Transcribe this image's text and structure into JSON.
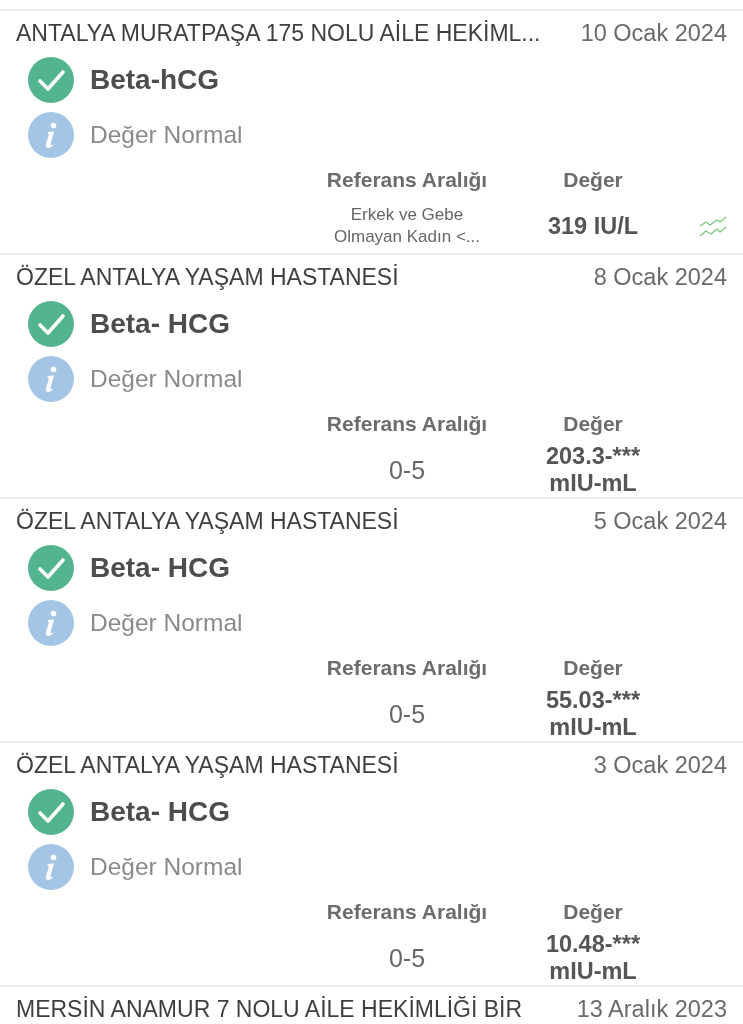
{
  "results": [
    {
      "institution": "ANTALYA MURATPAŞA 175 NOLU AİLE HEKİML...",
      "date": "10 Ocak 2024",
      "test": "Beta-hCG",
      "note": "Değer Normal",
      "columns": [
        "Referans Aralığı",
        "Değer"
      ],
      "reference": "Erkek ve Gebe Olmayan Kadın <...",
      "value": "319 IU/L",
      "trend": true
    },
    {
      "institution": "ÖZEL ANTALYA YAŞAM HASTANESİ",
      "date": "8 Ocak 2024",
      "test": "Beta- HCG",
      "note": "Değer Normal",
      "columns": [
        "Referans Aralığı",
        "Değer"
      ],
      "reference": "0-5",
      "value": "203.3-*** mIU-mL",
      "trend": false
    },
    {
      "institution": "ÖZEL ANTALYA YAŞAM HASTANESİ",
      "date": "5 Ocak 2024",
      "test": "Beta- HCG",
      "note": "Değer Normal",
      "columns": [
        "Referans Aralığı",
        "Değer"
      ],
      "reference": "0-5",
      "value": "55.03-*** mIU-mL",
      "trend": false
    },
    {
      "institution": "ÖZEL ANTALYA YAŞAM HASTANESİ",
      "date": "3 Ocak 2024",
      "test": "Beta- HCG",
      "note": "Değer Normal",
      "columns": [
        "Referans Aralığı",
        "Değer"
      ],
      "reference": "0-5",
      "value": "10.48-*** mIU-mL",
      "trend": false
    },
    {
      "institution": "MERSİN ANAMUR 7 NOLU AİLE HEKİMLİĞİ BİR",
      "date": "13 Aralık 2023"
    }
  ]
}
